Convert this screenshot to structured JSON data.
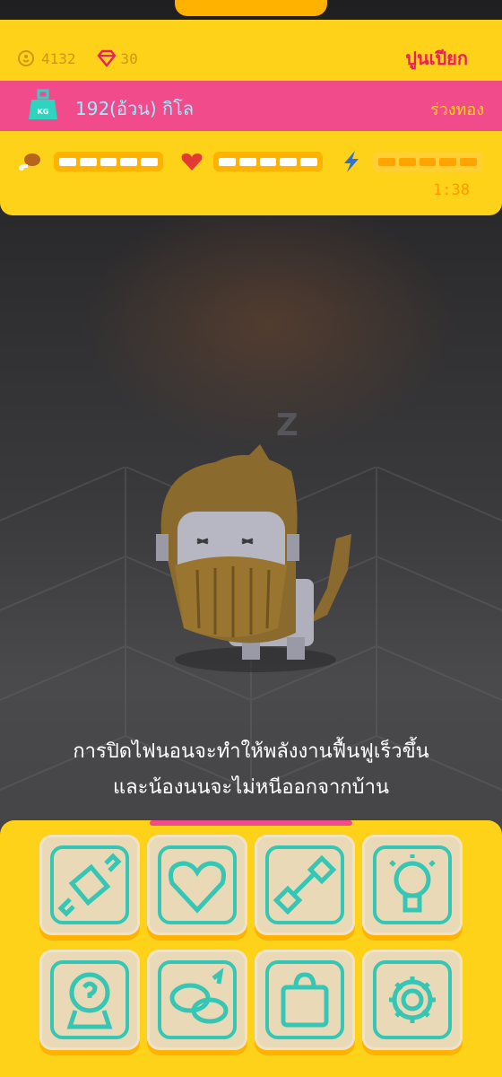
{
  "stats": {
    "coins": "4132",
    "gems": "30"
  },
  "pet": {
    "name": "ปูนเปียก"
  },
  "weight": {
    "text": "192(อ้วน) กิโล",
    "status": "ร่วงทอง"
  },
  "bars": {
    "food": {
      "filled": 5,
      "total": 5
    },
    "health": {
      "filled": 5,
      "total": 5
    },
    "energy": {
      "filled": 0,
      "total": 5
    }
  },
  "timer": "1:38",
  "message": {
    "line1": "การปิดไฟนอนจะทำให้พลังงานฟื้นฟูเร็วขึ้น",
    "line2": "และน้องนนจะไม่หนีออกจากบ้าน"
  },
  "actions": [
    {
      "icon": "candy-icon"
    },
    {
      "icon": "heart-icon"
    },
    {
      "icon": "dumbbell-icon"
    },
    {
      "icon": "lightbulb-icon"
    },
    {
      "icon": "question-bag-icon"
    },
    {
      "icon": "pets-icon"
    },
    {
      "icon": "shopping-bag-icon"
    },
    {
      "icon": "gear-icon"
    }
  ],
  "colors": {
    "panel": "#ffd21a",
    "accent_pink": "#f24b8c",
    "icon_teal": "#35c6b5",
    "button": "#e9d9b6"
  }
}
